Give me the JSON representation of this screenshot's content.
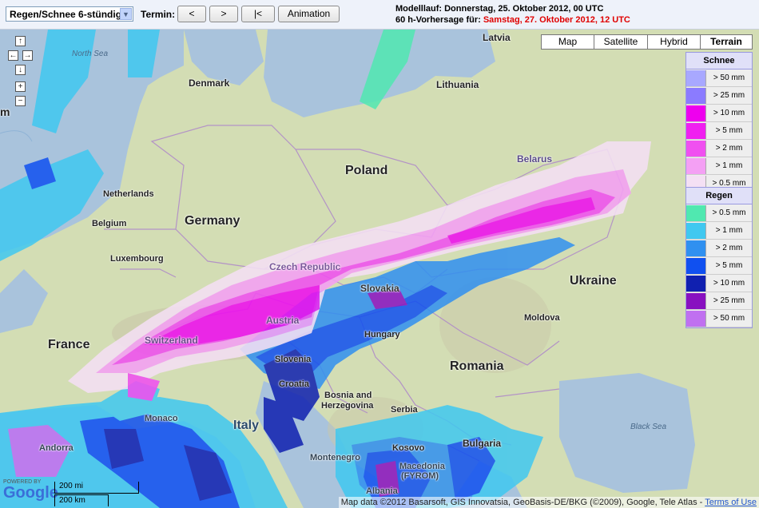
{
  "toolbar": {
    "product_select": "Regen/Schnee 6-stündig",
    "termin_label": "Termin:",
    "prev_btn": "<",
    "next_btn": ">",
    "first_btn": "|<",
    "animation_btn": "Animation",
    "run_text": "Modelllauf: Donnerstag, 25. Oktober 2012, 00 UTC",
    "forecast_prefix": "60 h-Vorhersage für: ",
    "forecast_date": "Samstag, 27. Oktober 2012, 12 UTC"
  },
  "map_type": {
    "map": "Map",
    "satellite": "Satellite",
    "hybrid": "Hybrid",
    "terrain": "Terrain",
    "selected": "Terrain"
  },
  "navigation": {
    "up": "↑",
    "left": "←",
    "right": "→",
    "down": "↓",
    "zoom_in": "+",
    "zoom_out": "−"
  },
  "legend": {
    "snow_title": "Schnee",
    "snow": [
      {
        "label": "> 50 mm",
        "color": "#a8a8ff"
      },
      {
        "label": "> 25 mm",
        "color": "#8b7bff"
      },
      {
        "label": "> 10 mm",
        "color": "#ee00ee"
      },
      {
        "label": "> 5 mm",
        "color": "#f020f0"
      },
      {
        "label": "> 2 mm",
        "color": "#f050f0"
      },
      {
        "label": "> 1 mm",
        "color": "#f4a0f4"
      },
      {
        "label": "> 0.5 mm",
        "color": "#f4e0f4"
      }
    ],
    "rain_title": "Regen",
    "rain": [
      {
        "label": "> 0.5 mm",
        "color": "#50e8b0"
      },
      {
        "label": "> 1 mm",
        "color": "#40c8f0"
      },
      {
        "label": "> 2 mm",
        "color": "#3090f0"
      },
      {
        "label": "> 5 mm",
        "color": "#1050f0"
      },
      {
        "label": "> 10 mm",
        "color": "#1020b0"
      },
      {
        "label": "> 25 mm",
        "color": "#8810c0"
      },
      {
        "label": "> 50 mm",
        "color": "#c070f0"
      }
    ]
  },
  "labels": {
    "latvia": "Latvia",
    "denmark": "Denmark",
    "lithuania": "Lithuania",
    "north_sea": "North Sea",
    "poland": "Poland",
    "belarus": "Belarus",
    "netherlands": "Netherlands",
    "germany": "Germany",
    "belgium": "Belgium",
    "luxembourg": "Luxembourg",
    "czech": "Czech Republic",
    "ukraine": "Ukraine",
    "slovakia": "Slovakia",
    "austria": "Austria",
    "moldova": "Moldova",
    "hungary": "Hungary",
    "france": "France",
    "switzerland": "Switzerland",
    "slovenia": "Slovenia",
    "romania": "Romania",
    "croatia": "Croatia",
    "bosnia": "Bosnia and",
    "herzegovina": "Herzegovina",
    "serbia": "Serbia",
    "monaco": "Monaco",
    "italy": "Italy",
    "black_sea": "Black Sea",
    "andorra": "Andorra",
    "kosovo": "Kosovo",
    "bulgaria": "Bulgaria",
    "montenegro": "Montenegro",
    "macedonia": "Macedonia",
    "fyrom": "(FYROM)",
    "albania": "Albania",
    "edge_m": "m"
  },
  "scale": {
    "mi": "200 mi",
    "km": "200 km"
  },
  "google": {
    "powered": "POWERED BY",
    "logo": "Google"
  },
  "copyright": {
    "text": "Map data ©2012 Basarsoft, GIS Innovatsia, GeoBasis-DE/BKG (©2009), Google, Tele Atlas - ",
    "terms": "Terms of Use"
  }
}
